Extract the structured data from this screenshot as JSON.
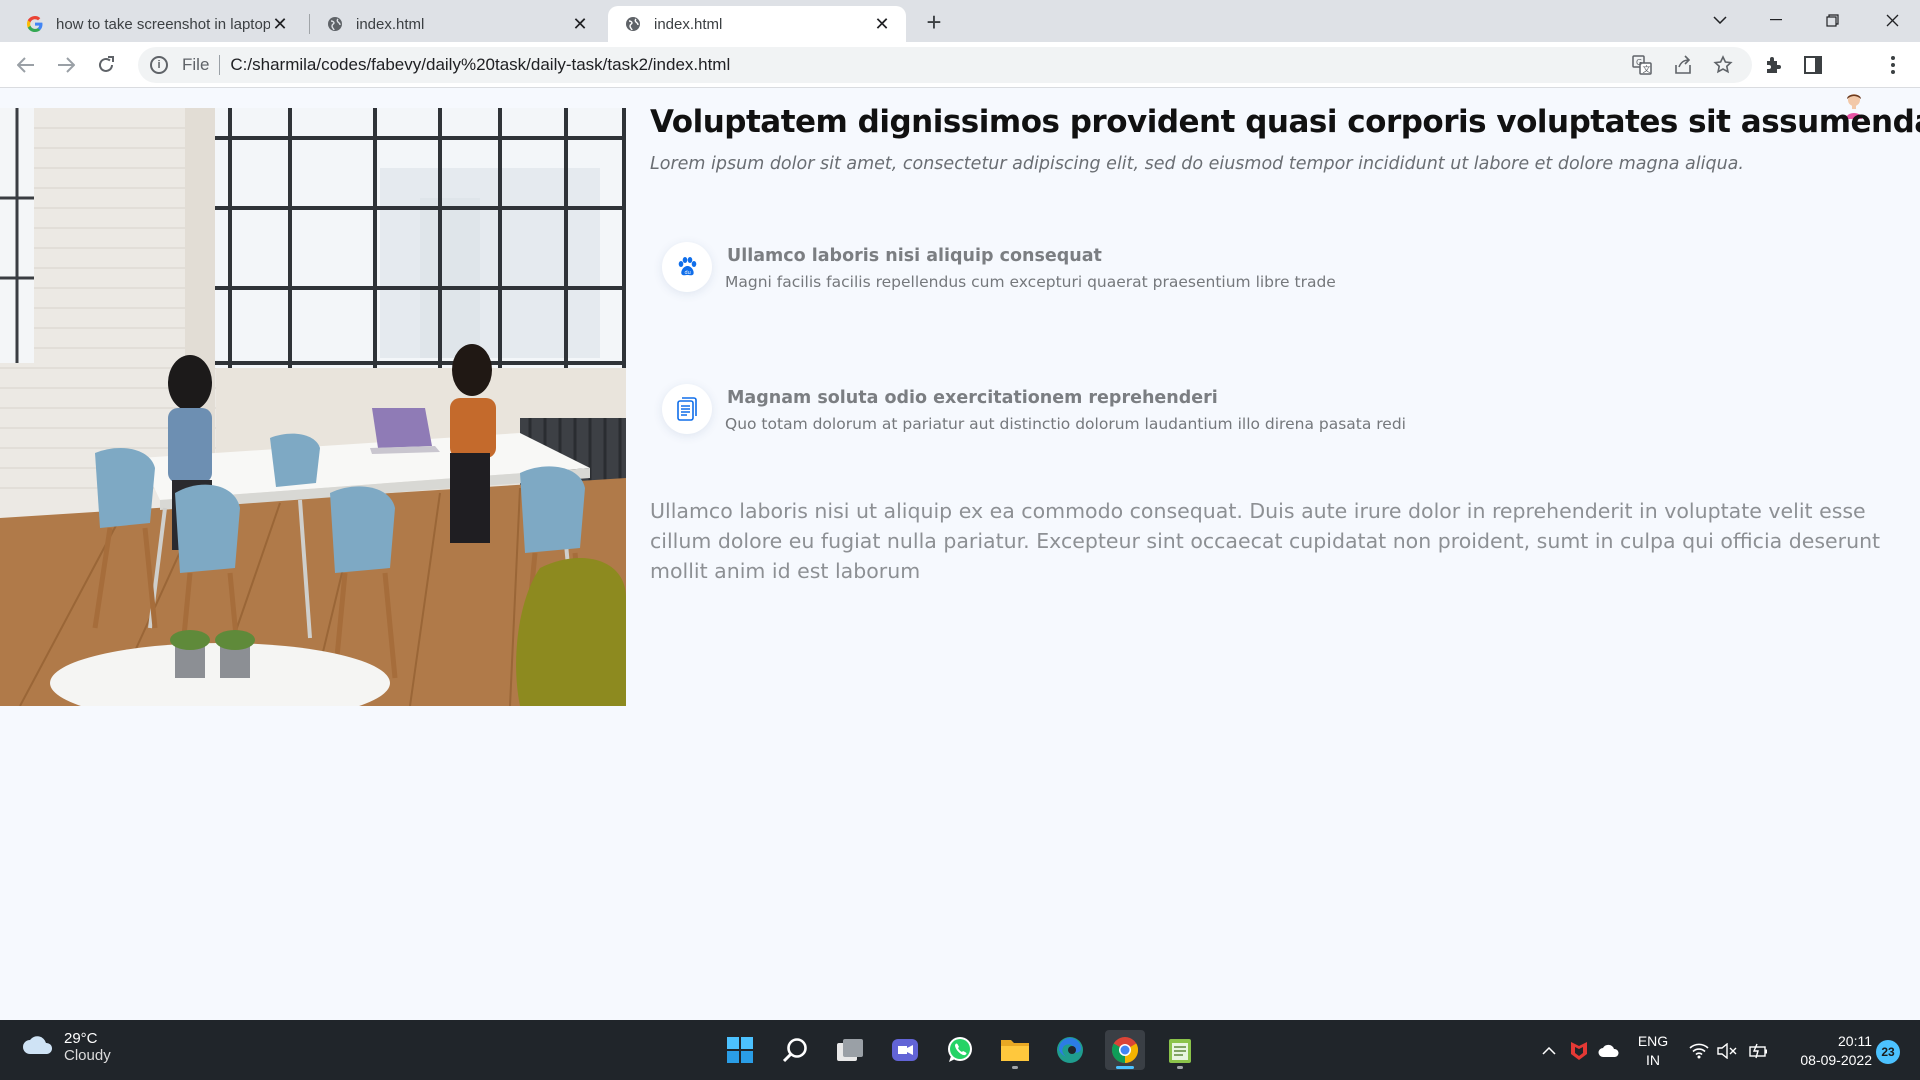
{
  "browser": {
    "tabs": [
      {
        "title": "how to take screenshot in laptop",
        "favicon": "google-icon",
        "active": false
      },
      {
        "title": "index.html",
        "favicon": "globe-icon",
        "active": false
      },
      {
        "title": "index.html",
        "favicon": "globe-icon",
        "active": true
      }
    ],
    "new_tab_label": "+",
    "address": {
      "scheme_label": "File",
      "url": "C:/sharmila/codes/fabevy/daily%20task/daily-task/task2/index.html"
    },
    "toolbar_icons": [
      "translate-icon",
      "share-icon",
      "bookmark-star-icon",
      "extensions-icon",
      "side-panel-icon",
      "profile-avatar",
      "menu-icon"
    ]
  },
  "page": {
    "headline": "Voluptatem dignissimos provident quasi corporis voluptates sit assumenda.",
    "subtitle": "Lorem ipsum dolor sit amet, consectetur adipiscing elit, sed do eiusmod tempor incididunt ut labore et dolore magna aliqua.",
    "features": [
      {
        "icon": "paw-icon",
        "title": "Ullamco laboris nisi aliquip consequat",
        "desc": "Magni facilis facilis repellendus cum excepturi quaerat praesentium libre trade"
      },
      {
        "icon": "document-icon",
        "title": "Magnam soluta odio exercitationem reprehenderi",
        "desc": "Quo totam dolorum at pariatur aut distinctio dolorum laudantium illo direna pasata redi"
      }
    ],
    "paragraph": "Ullamco laboris nisi ut aliquip ex ea commodo consequat. Duis aute irure dolor in reprehenderit in voluptate velit esse cillum dolore eu fugiat nulla pariatur. Excepteur sint occaecat cupidatat non proident, sumt in culpa qui officia deserunt mollit anim id est laborum",
    "accent_color": "#106eea"
  },
  "taskbar": {
    "weather": {
      "temp": "29°C",
      "condition": "Cloudy"
    },
    "apps": [
      "windows-start-icon",
      "search-icon",
      "task-view-icon",
      "teams-chat-icon",
      "whatsapp-icon",
      "file-explorer-icon",
      "edge-icon",
      "chrome-icon",
      "notepad-icon"
    ],
    "language": {
      "line1": "ENG",
      "line2": "IN"
    },
    "clock": {
      "time": "20:11",
      "date": "08-09-2022"
    },
    "notification_count": "23"
  }
}
